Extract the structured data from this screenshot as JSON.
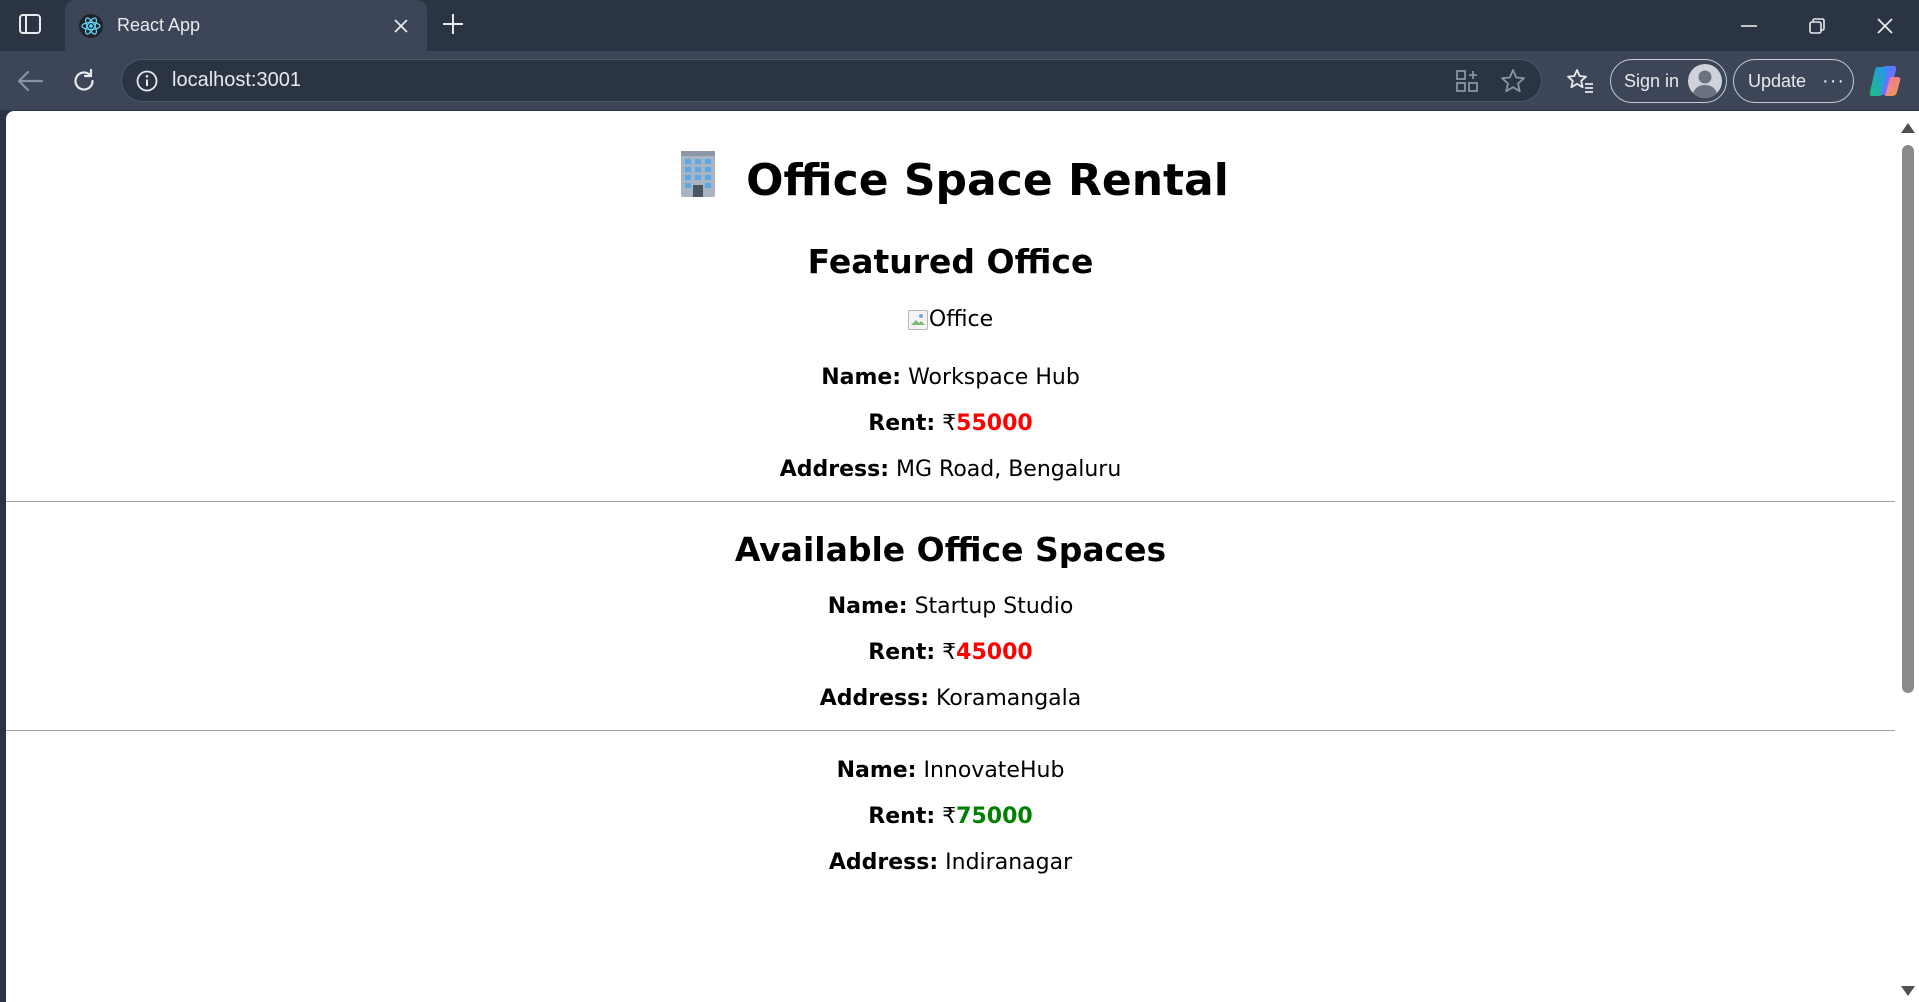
{
  "browser": {
    "tab": {
      "title": "React App",
      "favicon": "react-logo-icon"
    },
    "address_bar": {
      "url": "localhost:3001"
    },
    "sign_in_label": "Sign in",
    "update_label": "Update",
    "colors": {
      "frame": "#2b3443",
      "toolbar": "#3c4658",
      "text": "#e8eaed"
    }
  },
  "page": {
    "title": "Office Space Rental",
    "title_icon": "office-building-emoji",
    "featured": {
      "heading": "Featured Office",
      "image_alt": "Office",
      "name_label": "Name:",
      "name": "Workspace Hub",
      "rent_label": "Rent:",
      "currency": "₹",
      "rent": "55000",
      "rent_color": "#ff0000",
      "address_label": "Address:",
      "address": "MG Road, Bengaluru"
    },
    "available_heading": "Available Office Spaces",
    "offices": [
      {
        "name_label": "Name:",
        "name": "Startup Studio",
        "rent_label": "Rent:",
        "currency": "₹",
        "rent": "45000",
        "rent_color": "#ff0000",
        "address_label": "Address:",
        "address": "Koramangala"
      },
      {
        "name_label": "Name:",
        "name": "InnovateHub",
        "rent_label": "Rent:",
        "currency": "₹",
        "rent": "75000",
        "rent_color": "#008000",
        "address_label": "Address:",
        "address": "Indiranagar"
      }
    ]
  }
}
